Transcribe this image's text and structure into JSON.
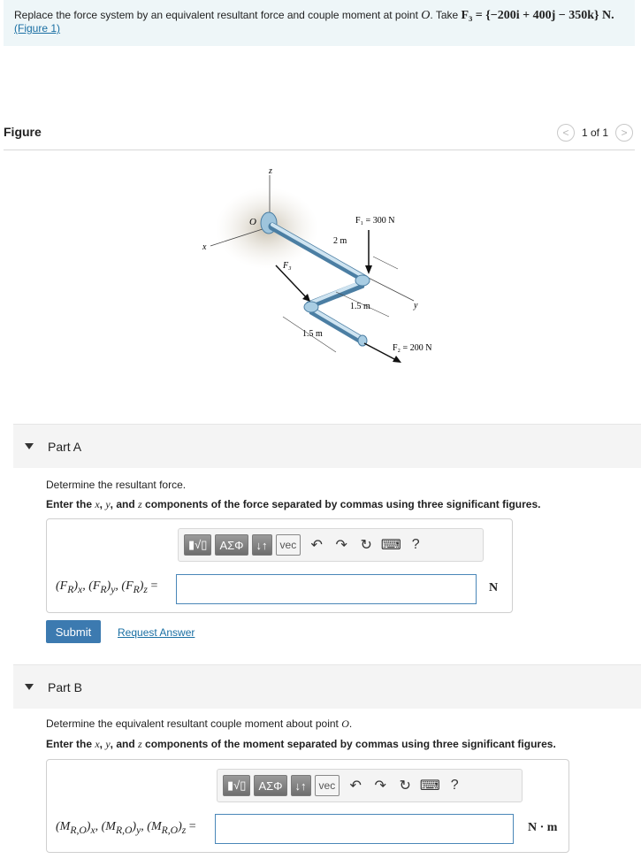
{
  "problem": {
    "text": "Replace the force system by an equivalent resultant force and couple moment at point ",
    "point": "O",
    "take": ". Take ",
    "f3": "F₃ = {−200i + 400j − 350k} N.",
    "figure_link": "(Figure 1)"
  },
  "figure": {
    "title": "Figure",
    "pager": "1 of 1",
    "prev": "<",
    "next": ">",
    "labels": {
      "z": "z",
      "x": "x",
      "y": "y",
      "o": "O",
      "f1": "F₁ = 300 N",
      "f2": "F₂ = 200 N",
      "f3": "F₃",
      "d1": "2 m",
      "d2": "1.5 m",
      "d3": "1.5 m"
    }
  },
  "part_a": {
    "title": "Part A",
    "instruction": "Determine the resultant force.",
    "task": "Enter the x, y, and z components of the force separated by commas using three significant figures.",
    "eq_label": "(F_R)x, (F_R)y, (F_R)z =",
    "unit": "N",
    "toolbar": {
      "templates": "▮√▯",
      "greek": "ΑΣΦ",
      "arrows": "↓↑",
      "vec": "vec",
      "help": "?"
    },
    "submit": "Submit",
    "request": "Request Answer",
    "value": ""
  },
  "part_b": {
    "title": "Part B",
    "instruction": "Determine the equivalent resultant couple moment about point O.",
    "task": "Enter the x, y, and z components of the moment separated by commas using three significant figures.",
    "eq_label": "(M_R,O)x, (M_R,O)y, (M_R,O)z =",
    "unit": "N · m",
    "toolbar": {
      "templates": "▮√▯",
      "greek": "ΑΣΦ",
      "arrows": "↓↑",
      "vec": "vec",
      "help": "?"
    },
    "value": ""
  }
}
